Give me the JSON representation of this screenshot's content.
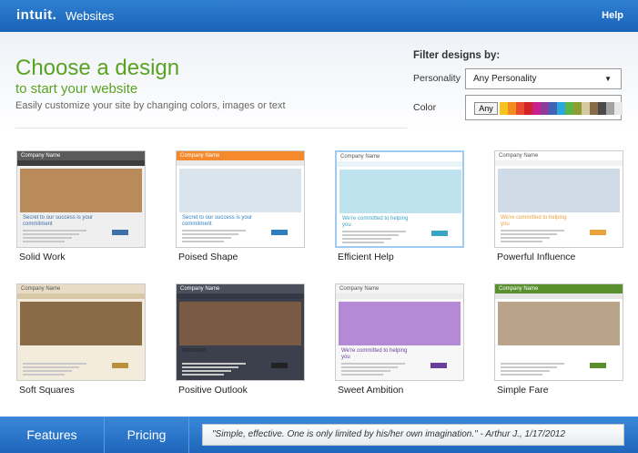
{
  "header": {
    "logo": "intuit.",
    "product": "Websites",
    "help": "Help"
  },
  "hero": {
    "title": "Choose a design",
    "subtitle": "to start your website",
    "tagline": "Easily customize your site by changing colors, images or text"
  },
  "filter": {
    "title": "Filter designs by:",
    "personality_label": "Personality",
    "personality_value": "Any Personality",
    "color_label": "Color",
    "any_label": "Any",
    "swatches": [
      "#f6c21c",
      "#f18d1e",
      "#e84b2e",
      "#d2232a",
      "#c5208d",
      "#8e3c9a",
      "#3f64b5",
      "#2aa7dd",
      "#5bb443",
      "#8f9c33",
      "#d5c9a2",
      "#8a6b47",
      "#4a4a4a",
      "#a3a3a3",
      "#e8e8e8"
    ]
  },
  "designs": [
    {
      "name": "Solid Work",
      "company": "Company Name",
      "text": "Secret to our success is your commitment"
    },
    {
      "name": "Poised Shape",
      "company": "Company Name",
      "text": "Secret to our success is your commitment"
    },
    {
      "name": "Efficient Help",
      "company": "Company Name",
      "text": "We're committed to helping you"
    },
    {
      "name": "Powerful Influence",
      "company": "Company Name",
      "text": "We're committed to helping you"
    },
    {
      "name": "Soft Squares",
      "company": "Company Name",
      "text": ""
    },
    {
      "name": "Positive Outlook",
      "company": "Company Name",
      "text": "Welcome!"
    },
    {
      "name": "Sweet Ambition",
      "company": "Company Name",
      "text": "We're committed to helping you"
    },
    {
      "name": "Simple Fare",
      "company": "Company Name",
      "text": ""
    }
  ],
  "footer": {
    "features": "Features",
    "pricing": "Pricing",
    "quote": "\"Simple, effective. One is only limited by his/her own imagination.\" - Arthur J., 1/17/2012"
  }
}
